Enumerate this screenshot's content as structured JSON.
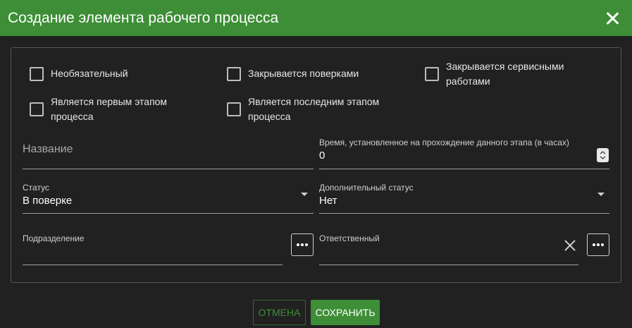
{
  "dialog": {
    "title": "Создание элемента рабочего процесса"
  },
  "checkboxes": {
    "optional": "Необязательный",
    "closed_by_checks": "Закрывается поверками",
    "closed_by_service": "Закрывается сервисными работами",
    "is_first_stage": "Является первым этапом процесса",
    "is_last_stage": "Является последним этапом процесса"
  },
  "fields": {
    "name": {
      "placeholder": "Название"
    },
    "time": {
      "label": "Время, установленное на прохождение данного этапа (в часах)",
      "value": "0"
    },
    "status": {
      "label": "Статус",
      "value": "В поверке"
    },
    "extra_status": {
      "label": "Дополнительный статус",
      "value": "Нет"
    },
    "department": {
      "label": "Подразделение",
      "value": ""
    },
    "responsible": {
      "label": "Ответственный",
      "value": ""
    }
  },
  "buttons": {
    "cancel": "ОТМЕНА",
    "save": "СОХРАНИТЬ"
  },
  "colors": {
    "accent": "#3d8e36",
    "background": "#212121"
  }
}
